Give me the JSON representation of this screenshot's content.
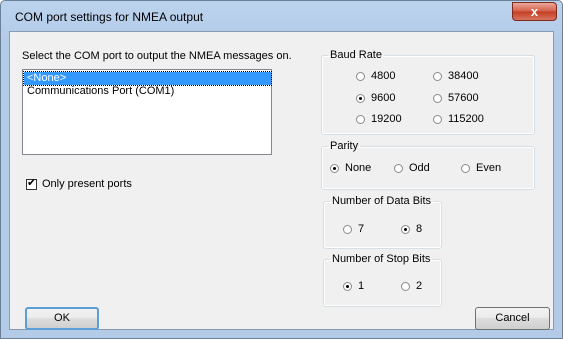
{
  "window": {
    "title": "COM port settings for NMEA output",
    "close_glyph": "x"
  },
  "port_section": {
    "instruction": "Select the COM port to output the NMEA messages on.",
    "list_items": [
      {
        "label": "<None>",
        "selected": true
      },
      {
        "label": "Communications Port (COM1)",
        "selected": false
      }
    ],
    "only_present_ports": {
      "label": "Only present ports",
      "checked": true
    }
  },
  "baud_rate": {
    "legend": "Baud Rate",
    "options": [
      {
        "label": "4800",
        "selected": false
      },
      {
        "label": "38400",
        "selected": false
      },
      {
        "label": "9600",
        "selected": true
      },
      {
        "label": "57600",
        "selected": false
      },
      {
        "label": "19200",
        "selected": false
      },
      {
        "label": "115200",
        "selected": false
      }
    ]
  },
  "parity": {
    "legend": "Parity",
    "options": [
      {
        "label": "None",
        "selected": true
      },
      {
        "label": "Odd",
        "selected": false
      },
      {
        "label": "Even",
        "selected": false
      }
    ]
  },
  "data_bits": {
    "legend": "Number of Data Bits",
    "options": [
      {
        "label": "7",
        "selected": false
      },
      {
        "label": "8",
        "selected": true
      }
    ]
  },
  "stop_bits": {
    "legend": "Number of Stop Bits",
    "options": [
      {
        "label": "1",
        "selected": true
      },
      {
        "label": "2",
        "selected": false
      }
    ]
  },
  "buttons": {
    "ok": "OK",
    "cancel": "Cancel"
  }
}
